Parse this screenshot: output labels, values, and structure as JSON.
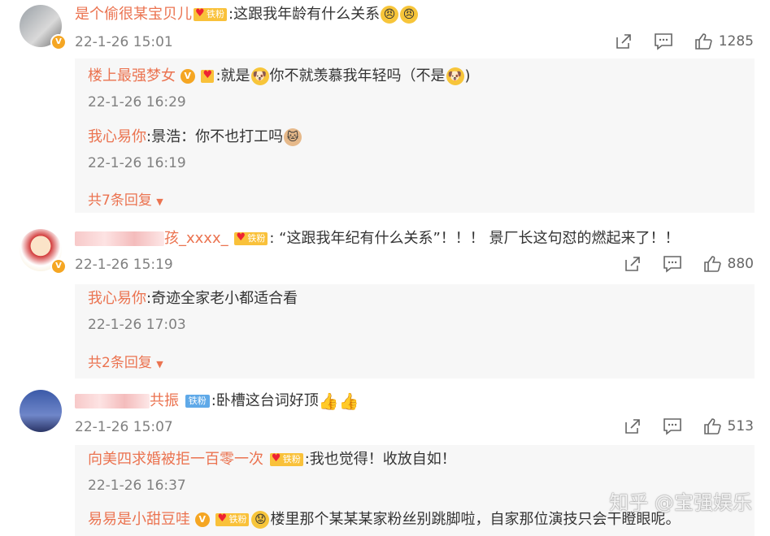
{
  "posts": [
    {
      "username": "是个偷很某宝贝儿",
      "fan_badge": "铁粉",
      "text": ":这跟我年龄有什么关系",
      "time": "22-1-26 15:01",
      "likes": "1285",
      "replies": [
        {
          "username": "楼上最强梦女",
          "fan_badge": "",
          "text": ":就是",
          "text2": "你不就羡慕我年轻吗（不是",
          "text3": ")",
          "time": "22-1-26 16:29"
        },
        {
          "username": "我心易你",
          "text": ":景浩：你不也打工吗",
          "time": "22-1-26 16:19"
        }
      ],
      "more": "共7条回复"
    },
    {
      "username_suffix": "孩_xxxx_",
      "fan_badge": "铁粉",
      "text": ": “这跟我年纪有什么关系”！！！ 景厂长这句怼的燃起来了！！",
      "time": "22-1-26 15:19",
      "likes": "880",
      "replies": [
        {
          "username": "我心易你",
          "text": ":奇迹全家老小都适合看",
          "time": "22-1-26 17:03"
        }
      ],
      "more": "共2条回复"
    },
    {
      "username_suffix": "共振",
      "fan_badge": "铁粉",
      "text": ":卧槽这台词好顶",
      "time": "22-1-26 15:07",
      "likes": "513",
      "replies": [
        {
          "username": "向美四求婚被拒一百零一次",
          "fan_badge": "铁粉",
          "text": ":我也觉得！收放自如！",
          "time": "22-1-26 16:37"
        },
        {
          "username": "易易是小甜豆哇",
          "fan_badge": "铁粉",
          "text": "楼里那个某某某家粉丝别跳脚啦，自家那位演技只会干瞪眼呢。"
        }
      ]
    }
  ],
  "watermark": "知乎 @宝强娱乐"
}
